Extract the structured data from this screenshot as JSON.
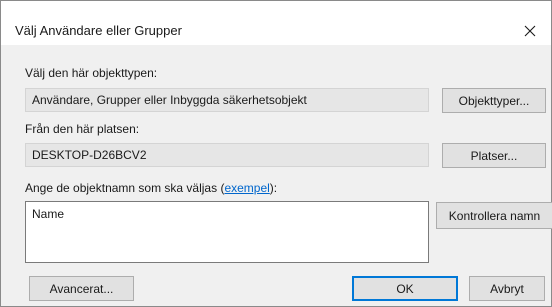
{
  "window": {
    "title": "Välj Användare eller Grupper"
  },
  "object_type": {
    "label": "Välj den här objekttypen:",
    "value": "Användare, Grupper eller Inbyggda säkerhetsobjekt",
    "button": "Objekttyper..."
  },
  "location": {
    "label": "Från den här platsen:",
    "value": "DESKTOP-D26BCV2",
    "button": "Platser..."
  },
  "names": {
    "label_prefix": "Ange de objektnamn som ska väljas (",
    "label_link": "exempel",
    "label_suffix": "):",
    "value": "Name",
    "check_button": "Kontrollera namn"
  },
  "footer": {
    "advanced_button": "Avancerat...",
    "ok_button": "OK",
    "cancel_button": "Avbryt"
  },
  "icons": {
    "close": "close-icon"
  }
}
